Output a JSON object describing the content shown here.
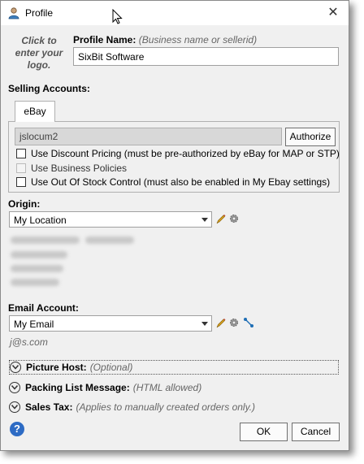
{
  "window": {
    "title": "Profile"
  },
  "logo_hint": {
    "line1": "Click to",
    "line2": "enter your",
    "line3": "logo."
  },
  "profile_name": {
    "label": "Profile Name:",
    "hint": "(Business name or sellerid)",
    "value": "SixBit Software"
  },
  "selling_accounts": {
    "label": "Selling Accounts:",
    "tab": "eBay",
    "account_value": "jslocum2",
    "authorize_button": "Authorize",
    "checkboxes": [
      {
        "label": "Use Discount Pricing (must be pre-authorized by eBay for MAP or STP)",
        "checked": false,
        "enabled": true
      },
      {
        "label": "Use Business Policies",
        "checked": false,
        "enabled": false
      },
      {
        "label": "Use Out Of Stock Control (must also be enabled in My Ebay settings)",
        "checked": false,
        "enabled": true
      }
    ]
  },
  "origin": {
    "label": "Origin:",
    "value": "My Location"
  },
  "email_account": {
    "label": "Email Account:",
    "value": "My Email",
    "address": "j@s.com"
  },
  "sections": [
    {
      "title": "Picture Host:",
      "hint": "(Optional)"
    },
    {
      "title": "Packing List Message:",
      "hint": "(HTML allowed)"
    },
    {
      "title": "Sales Tax:",
      "hint": "(Applies to manually created orders only.)"
    }
  ],
  "footer": {
    "ok_button": "OK",
    "cancel_button": "Cancel"
  },
  "colors": {
    "help_icon": "#2d6bc4",
    "edit_icon": "#d9a21c",
    "connect_icon": "#1f6fb5"
  }
}
